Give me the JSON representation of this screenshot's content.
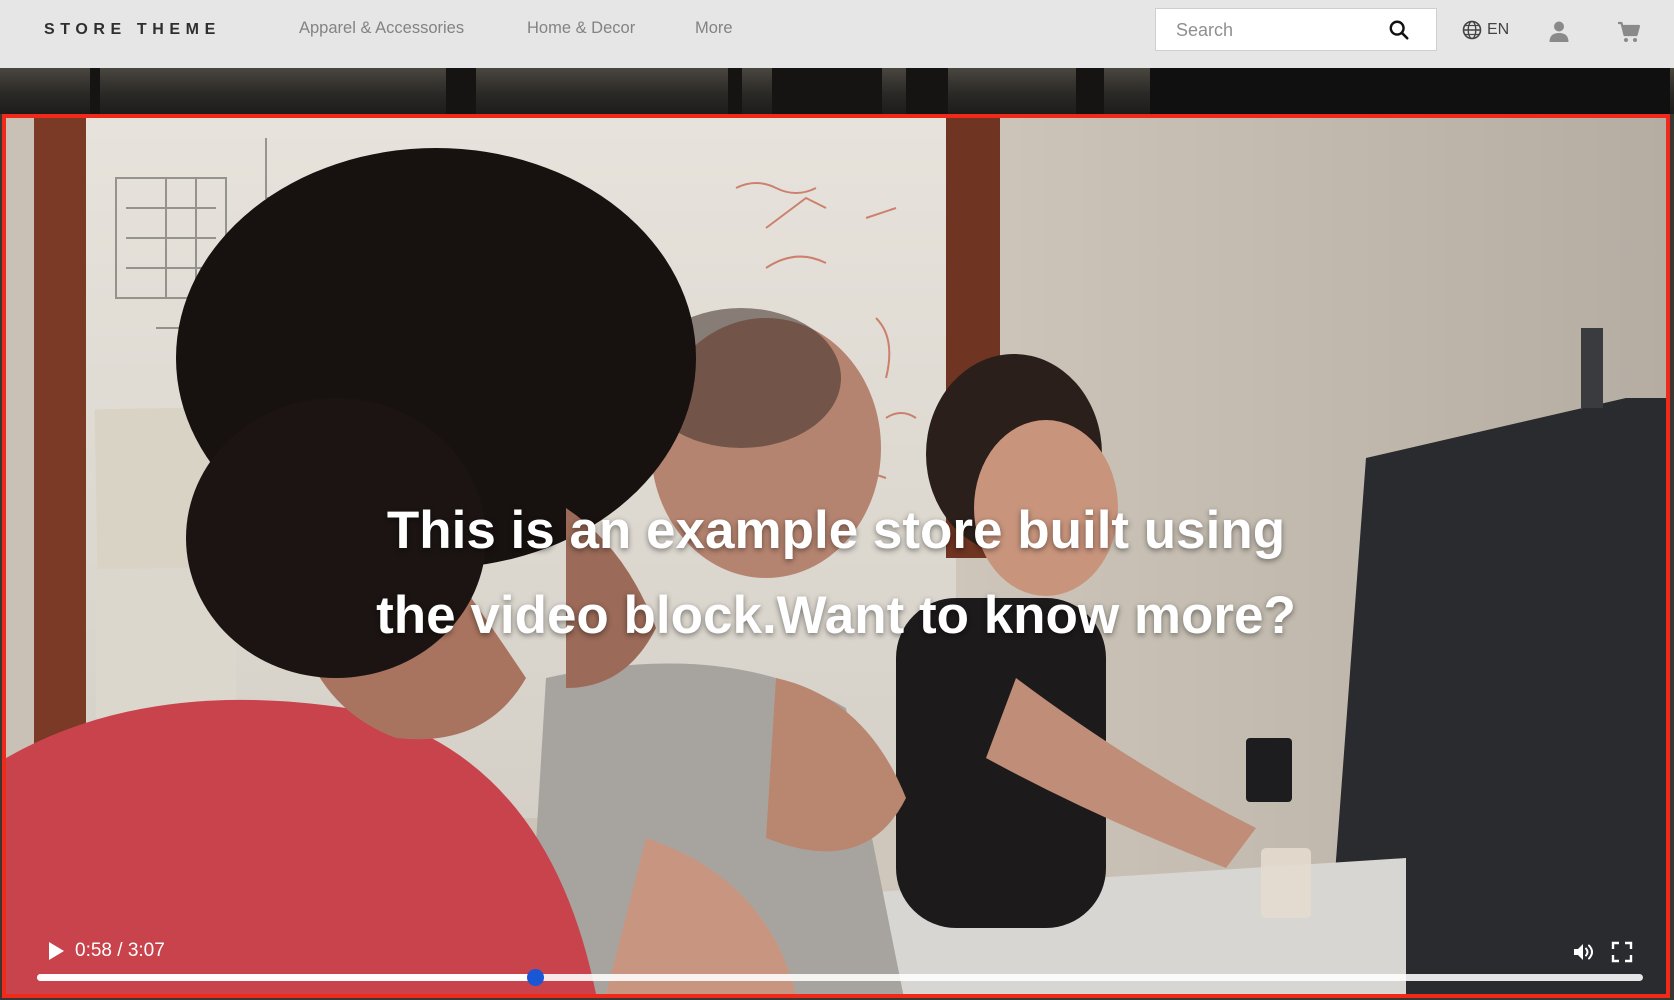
{
  "header": {
    "logo": "STORE THEME",
    "nav": [
      {
        "label": "Apparel & Accessories"
      },
      {
        "label": "Home & Decor"
      },
      {
        "label": "More"
      }
    ],
    "search": {
      "placeholder": "Search",
      "value": ""
    },
    "language": "EN",
    "icons": [
      "search-icon",
      "globe-icon",
      "user-icon",
      "cart-icon"
    ]
  },
  "video": {
    "caption": {
      "line1": "This is an example store built using",
      "line2": "the video block.Want to know more?"
    },
    "controls": {
      "time": "0:58 / 3:07",
      "progress": 0.31,
      "icons": [
        "play-icon",
        "volume-icon",
        "fullscreen-icon"
      ]
    }
  },
  "colors": {
    "highlight_border": "#ef2a1a",
    "progress_handle": "#1a57d6",
    "header_bg": "#ececec"
  }
}
